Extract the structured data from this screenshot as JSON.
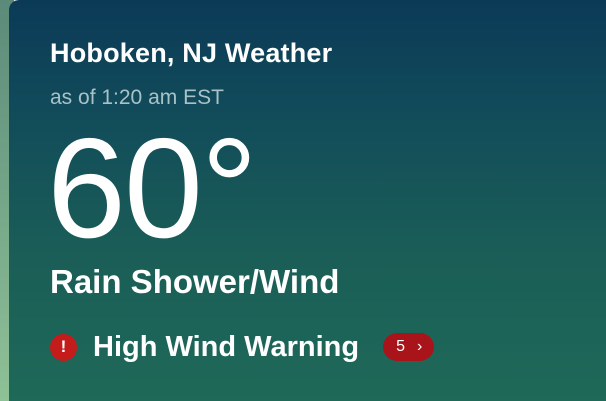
{
  "weather": {
    "location_title": "Hoboken, NJ Weather",
    "updated": "as of 1:20 am EST",
    "temperature": "60°",
    "condition": "Rain Shower/Wind"
  },
  "alert": {
    "icon": "!",
    "title": "High Wind Warning",
    "count": "5",
    "chevron": "›",
    "icon_name": "alert-exclamation-icon"
  },
  "colors": {
    "card_top": "#0b3a57",
    "card_bottom": "#1f6a58",
    "alert_red": "#c41b1b",
    "pill_red": "#a8141a",
    "muted_text": "#a9c2c8"
  }
}
